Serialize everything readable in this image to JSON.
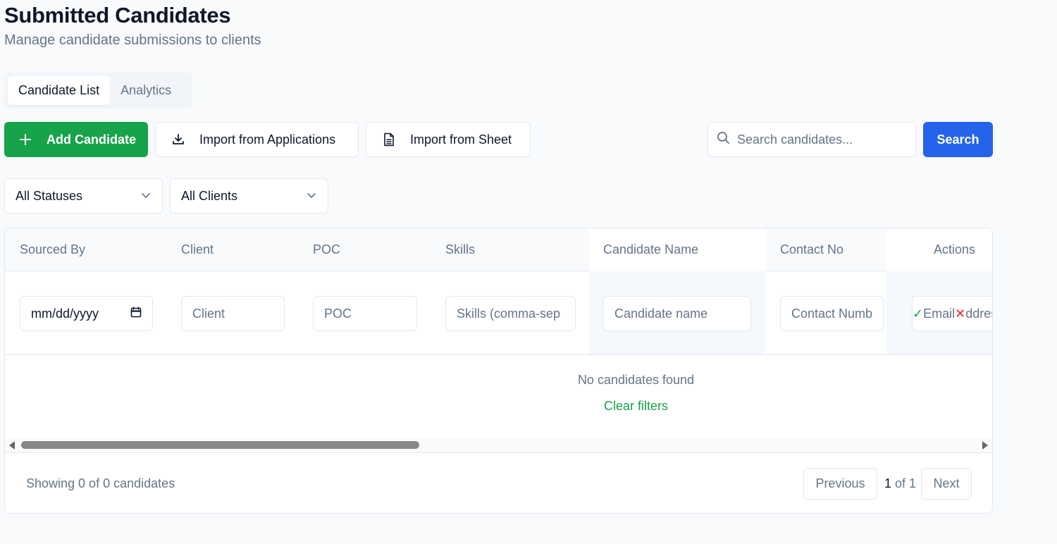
{
  "header": {
    "title": "Submitted Candidates",
    "subtitle": "Manage candidate submissions to clients"
  },
  "tabs": [
    {
      "label": "Candidate List",
      "active": true
    },
    {
      "label": "Analytics",
      "active": false
    }
  ],
  "toolbar": {
    "add_label": "Add Candidate",
    "import_applications_label": "Import from Applications",
    "import_sheet_label": "Import from Sheet",
    "search_placeholder": "Search candidates...",
    "search_label": "Search"
  },
  "filters": {
    "status_selected": "All Statuses",
    "client_selected": "All Clients"
  },
  "table": {
    "columns": [
      "Sourced By",
      "Client",
      "POC",
      "Skills",
      "Candidate Name",
      "Contact No",
      "Actions"
    ],
    "filter_inputs": {
      "date_value": "mm/dd/yyyy",
      "client_placeholder": "Client",
      "poc_placeholder": "POC",
      "skills_placeholder": "Skills (comma-sep",
      "candidate_name_placeholder": "Candidate name",
      "contact_placeholder": "Contact Numb",
      "email_placeholder": "Email",
      "email_placeholder_tail": "ddres"
    },
    "empty_message": "No candidates found",
    "clear_filters_label": "Clear filters"
  },
  "footer": {
    "showing_text": "Showing 0 of 0 candidates",
    "previous_label": "Previous",
    "current_page": "1",
    "page_of": " of 1",
    "next_label": "Next"
  },
  "colors": {
    "primary_green": "#16a34a",
    "primary_blue": "#2563eb",
    "border": "#e2e8f0",
    "muted_text": "#64748b"
  },
  "icons": {
    "add": "plus-icon",
    "import_applications": "download-icon",
    "import_sheet": "file-sheet-icon",
    "search": "search-icon",
    "select": "chevron-down-icon",
    "date": "calendar-icon",
    "confirm": "check-icon",
    "cancel": "x-icon"
  }
}
